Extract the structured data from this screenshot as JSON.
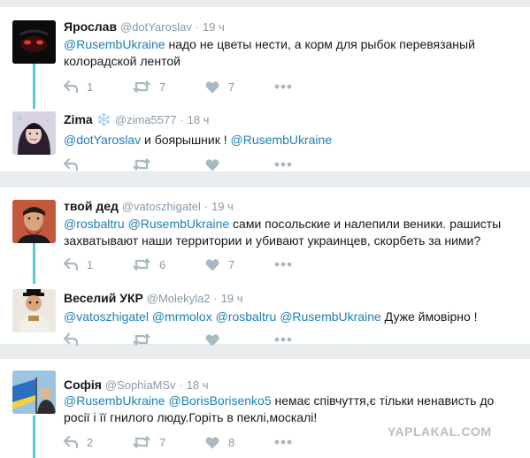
{
  "tweets": [
    {
      "name": "Ярослав",
      "handle": "@dotYaroslav",
      "time": "19 ч",
      "segments": [
        {
          "t": "@RusembUkraine",
          "m": true
        },
        {
          "t": " надо не цветы нести, а корм для рыбок перевязаный колорадской лентой",
          "m": false
        }
      ],
      "reply_count": "1",
      "retweet_count": "7",
      "like_count": "7"
    },
    {
      "name": "Zima",
      "badge": "❄️",
      "handle": "@zima5577",
      "time": "18 ч",
      "segments": [
        {
          "t": "@dotYaroslav",
          "m": true
        },
        {
          "t": " и боярышник ! ",
          "m": false
        },
        {
          "t": "@RusembUkraine",
          "m": true
        }
      ],
      "reply_count": "",
      "retweet_count": "",
      "like_count": ""
    },
    {
      "name": "твой дед",
      "handle": "@vatoszhigatel",
      "time": "19 ч",
      "segments": [
        {
          "t": "@rosbaltru",
          "m": true
        },
        {
          "t": " ",
          "m": false
        },
        {
          "t": "@RusembUkraine",
          "m": true
        },
        {
          "t": "  сами посольские и налепили веники. рашисты захватывают наши территории и убивают украинцев, скорбеть за ними?",
          "m": false
        }
      ],
      "reply_count": "1",
      "retweet_count": "6",
      "like_count": "7"
    },
    {
      "name": "Веселий УКР",
      "handle": "@Molekyla2",
      "time": "19 ч",
      "segments": [
        {
          "t": "@vatoszhigatel",
          "m": true
        },
        {
          "t": " ",
          "m": false
        },
        {
          "t": "@mrmolox",
          "m": true
        },
        {
          "t": " ",
          "m": false
        },
        {
          "t": "@rosbaltru",
          "m": true
        },
        {
          "t": " ",
          "m": false
        },
        {
          "t": "@RusembUkraine",
          "m": true
        },
        {
          "t": " Дуже ймовірно !",
          "m": false
        }
      ],
      "reply_count": "",
      "retweet_count": "",
      "like_count": ""
    },
    {
      "name": "Софія",
      "handle": "@SophiaMSv",
      "time": "18 ч",
      "segments": [
        {
          "t": "@RusembUkraine",
          "m": true
        },
        {
          "t": " ",
          "m": false
        },
        {
          "t": "@BorisBorisenko5",
          "m": true
        },
        {
          "t": " немає співчуття,є тільки ненависть до росії і її гнилого люду.Горіть в пеклі,москалі!",
          "m": false
        }
      ],
      "reply_count": "2",
      "retweet_count": "7",
      "like_count": "8"
    }
  ],
  "watermark": "YAPLAKAL.COM",
  "colors": {
    "mention": "#1d7fb5",
    "meta_gray": "#8899a6",
    "action_icon": "#aab8c2",
    "thread_line": "#5fc9d1",
    "background": "#e9edf0",
    "card": "#ffffff"
  },
  "icons": {
    "reply": "reply-arrow-icon",
    "retweet": "retweet-icon",
    "like": "heart-icon",
    "more": "more-dots-icon"
  }
}
